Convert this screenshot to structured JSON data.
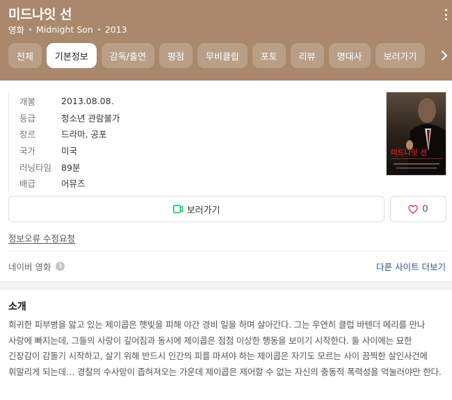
{
  "header": {
    "title": "미드나잇 선",
    "category": "영화",
    "original_title": "Midnight Son",
    "year": "2013",
    "more_icon": "kebab-menu-icon",
    "background_color": "#a9886b"
  },
  "tabs": [
    {
      "label": "전체",
      "active": false
    },
    {
      "label": "기본정보",
      "active": true
    },
    {
      "label": "감독/출연",
      "active": false
    },
    {
      "label": "평점",
      "active": false
    },
    {
      "label": "무비클립",
      "active": false
    },
    {
      "label": "포토",
      "active": false
    },
    {
      "label": "리뷰",
      "active": false
    },
    {
      "label": "명대사",
      "active": false
    },
    {
      "label": "보러가기",
      "active": false
    }
  ],
  "info": [
    {
      "label": "개봉",
      "value": "2013.08.08."
    },
    {
      "label": "등급",
      "value": "청소년 관람불가"
    },
    {
      "label": "장르",
      "value": "드라마, 공포"
    },
    {
      "label": "국가",
      "value": "미국"
    },
    {
      "label": "러닝타임",
      "value": "89분"
    },
    {
      "label": "배급",
      "value": "어뮤즈"
    }
  ],
  "poster": {
    "title_text": "미드나잇 선"
  },
  "actions": {
    "watch_label": "보러가기",
    "like_count": "0",
    "watch_icon": "play-screen-icon",
    "like_icon": "heart-outline-icon",
    "accent_green": "#03c75a",
    "heart_color": "#e8344e"
  },
  "report_link": "정보오류 수정요청",
  "source": {
    "label": "네이버 영화",
    "more_sites": "다른 사이트 더보기"
  },
  "synopsis": {
    "title": "소개",
    "text": "희귀한 피부병을 앓고 있는 제이콥은 햇빛을 피해 야간 경비 일을 하며 살아간다. 그는 우연히 클럽 바텐더 메리를 만나 사랑에 빠지는데, 그들의 사랑이 깊어짐과 동시에 제이콥은 점점 이상한 행동을 보이기 시작한다. 둘 사이에는 묘한 긴장감이 감돌기 시작하고, 살기 위해 반드시 인간의 피를 마셔야 하는 제이콥은 자기도 모르는 사이 끔찍한 살인사건에 휘말리게 되는데… 경찰의 수사망이 좁혀져오는 가운데 제이콥은 제어할 수 없는 자신의 충동적 폭력성을 억눌러야만 한다."
  }
}
